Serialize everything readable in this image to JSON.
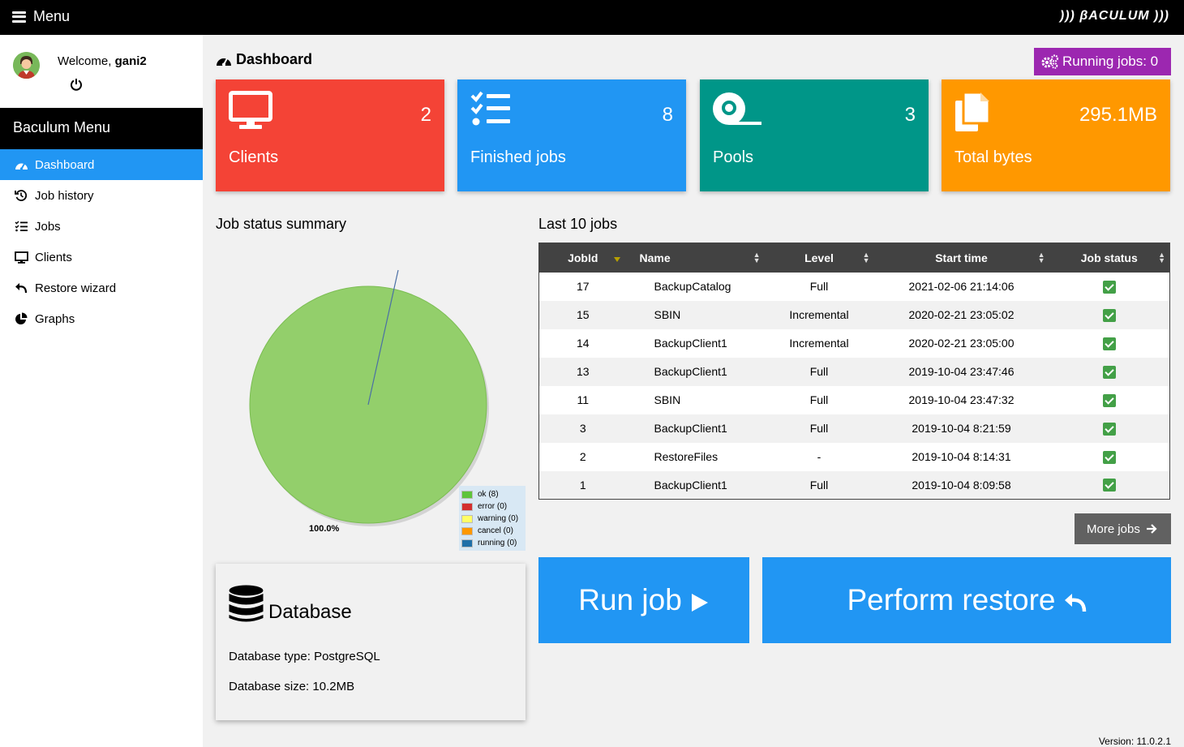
{
  "topbar": {
    "menu_label": "Menu",
    "logo": "))) βACULUM )))"
  },
  "sidebar": {
    "welcome_prefix": "Welcome,",
    "username": "gani2",
    "menu_title": "Baculum Menu",
    "items": [
      {
        "label": "Dashboard",
        "icon": "dashboard-icon",
        "active": true
      },
      {
        "label": "Job history",
        "icon": "history-icon"
      },
      {
        "label": "Jobs",
        "icon": "tasks-icon"
      },
      {
        "label": "Clients",
        "icon": "desktop-icon"
      },
      {
        "label": "Restore wizard",
        "icon": "undo-icon"
      },
      {
        "label": "Graphs",
        "icon": "pie-chart-icon"
      }
    ]
  },
  "header": {
    "title": "Dashboard",
    "running_jobs": "Running jobs: 0"
  },
  "cards": [
    {
      "label": "Clients",
      "value": "2",
      "color": "#f44336",
      "icon": "desktop-icon"
    },
    {
      "label": "Finished jobs",
      "value": "8",
      "color": "#2196f3",
      "icon": "tasks-icon"
    },
    {
      "label": "Pools",
      "value": "3",
      "color": "#009688",
      "icon": "tape-icon"
    },
    {
      "label": "Total bytes",
      "value": "295.1MB",
      "color": "#ff9800",
      "icon": "copy-icon"
    }
  ],
  "summary": {
    "title": "Job status summary",
    "pie_label": "100.0%",
    "legend": [
      {
        "label": "ok (8)",
        "color": "#5ec43b"
      },
      {
        "label": "error (0)",
        "color": "#d32f2f"
      },
      {
        "label": "warning (0)",
        "color": "#ffff66"
      },
      {
        "label": "cancel (0)",
        "color": "#ff9800"
      },
      {
        "label": "running (0)",
        "color": "#1f6fa8"
      }
    ]
  },
  "chart_data": {
    "type": "pie",
    "labels": [
      "ok",
      "error",
      "warning",
      "cancel",
      "running"
    ],
    "values": [
      8,
      0,
      0,
      0,
      0
    ],
    "title": "Job status summary"
  },
  "jobs": {
    "title": "Last 10 jobs",
    "columns": [
      "JobId",
      "Name",
      "Level",
      "Start time",
      "Job status"
    ],
    "rows": [
      {
        "id": "17",
        "name": "BackupCatalog",
        "level": "Full",
        "start": "2021-02-06 21:14:06"
      },
      {
        "id": "15",
        "name": "SBIN",
        "level": "Incremental",
        "start": "2020-02-21 23:05:02"
      },
      {
        "id": "14",
        "name": "BackupClient1",
        "level": "Incremental",
        "start": "2020-02-21 23:05:00"
      },
      {
        "id": "13",
        "name": "BackupClient1",
        "level": "Full",
        "start": "2019-10-04 23:47:46"
      },
      {
        "id": "11",
        "name": "SBIN",
        "level": "Full",
        "start": "2019-10-04 23:47:32"
      },
      {
        "id": "3",
        "name": "BackupClient1",
        "level": "Full",
        "start": "2019-10-04 8:21:59"
      },
      {
        "id": "2",
        "name": "RestoreFiles",
        "level": "-",
        "start": "2019-10-04 8:14:31"
      },
      {
        "id": "1",
        "name": "BackupClient1",
        "level": "Full",
        "start": "2019-10-04 8:09:58"
      }
    ],
    "more_label": "More jobs"
  },
  "database": {
    "title": "Database",
    "type_line": "Database type: PostgreSQL",
    "size_line": "Database size: 10.2MB"
  },
  "actions": {
    "run_job": "Run job",
    "restore": "Perform restore"
  },
  "footer": {
    "version": "Version: 11.0.2.1"
  }
}
